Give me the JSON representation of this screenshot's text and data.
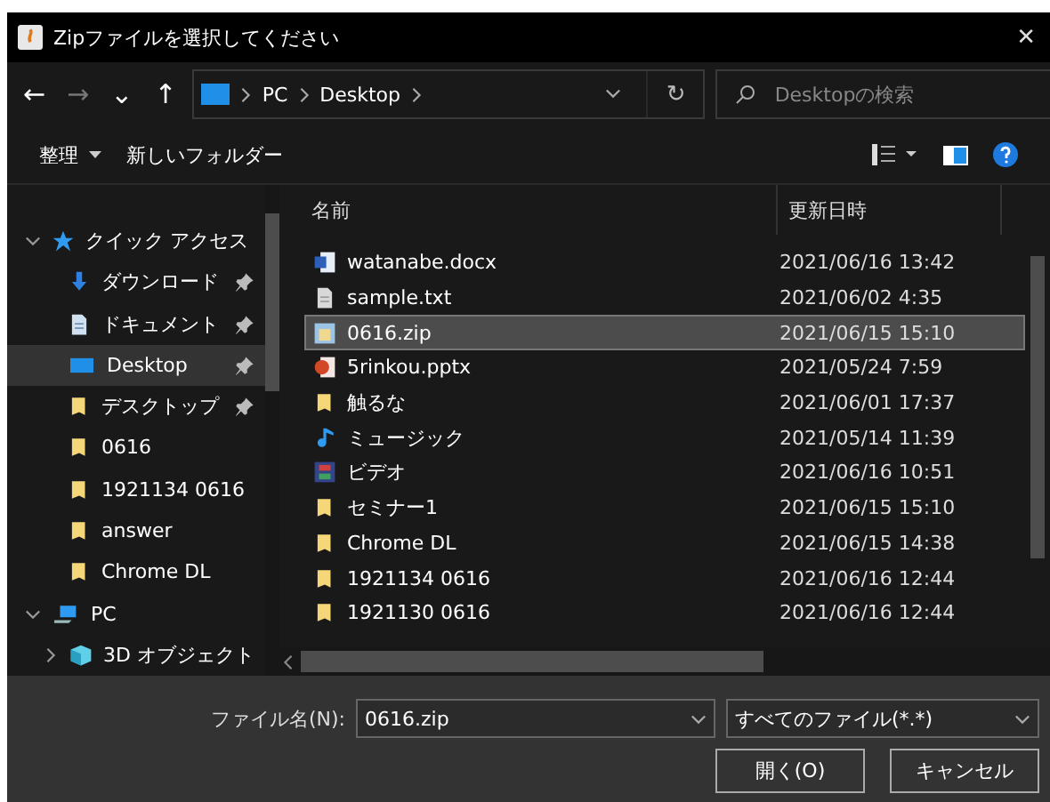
{
  "window": {
    "title": "Zipファイルを選択してください",
    "close": "✕"
  },
  "nav": {
    "back": "←",
    "forward": "→",
    "recent": "⌄",
    "up": "↑",
    "path": [
      {
        "label": "PC"
      },
      {
        "label": "Desktop"
      }
    ],
    "refresh": "↻",
    "search": {
      "placeholder": "Desktopの検索"
    }
  },
  "toolbar": {
    "organize": "整理",
    "new_folder": "新しいフォルダー"
  },
  "sidebar": {
    "items": [
      {
        "label": "クイック アクセス",
        "kind": "star",
        "selected": false,
        "pinned": false,
        "children": [
          {
            "label": "ダウンロード",
            "kind": "download",
            "selected": false,
            "pinned": true
          },
          {
            "label": "ドキュメント",
            "kind": "document",
            "selected": false,
            "pinned": true
          },
          {
            "label": "Desktop",
            "kind": "desktop",
            "selected": true,
            "pinned": true
          },
          {
            "label": "デスクトップ",
            "kind": "folder",
            "selected": false,
            "pinned": true
          },
          {
            "label": "0616",
            "kind": "folder",
            "selected": false,
            "pinned": false
          },
          {
            "label": "1921134 0616",
            "kind": "folder",
            "selected": false,
            "pinned": false
          },
          {
            "label": "answer",
            "kind": "folder",
            "selected": false,
            "pinned": false
          },
          {
            "label": "Chrome DL",
            "kind": "folder",
            "selected": false,
            "pinned": false
          }
        ]
      },
      {
        "label": "PC",
        "kind": "pc",
        "selected": false,
        "pinned": false,
        "children": [
          {
            "label": "3D オブジェクト",
            "kind": "cube",
            "selected": false,
            "pinned": false
          }
        ]
      }
    ]
  },
  "table": {
    "columns": [
      "名前",
      "更新日時"
    ],
    "rows": [
      {
        "name": "watanabe.docx",
        "date": "2021/06/16 13:42",
        "kind": "word",
        "selected": false
      },
      {
        "name": "sample.txt",
        "date": "2021/06/02 4:35",
        "kind": "text",
        "selected": false
      },
      {
        "name": "0616.zip",
        "date": "2021/06/15 15:10",
        "kind": "zip",
        "selected": true
      },
      {
        "name": "5rinkou.pptx",
        "date": "2021/05/24 7:59",
        "kind": "slides",
        "selected": false
      },
      {
        "name": "触るな",
        "date": "2021/06/01 17:37",
        "kind": "folder",
        "selected": false
      },
      {
        "name": "ミュージック",
        "date": "2021/05/14 11:39",
        "kind": "music",
        "selected": false
      },
      {
        "name": "ビデオ",
        "date": "2021/06/16 10:51",
        "kind": "video",
        "selected": false
      },
      {
        "name": "セミナー1",
        "date": "2021/06/15 15:10",
        "kind": "folder",
        "selected": false
      },
      {
        "name": "Chrome DL",
        "date": "2021/06/15 14:38",
        "kind": "folder",
        "selected": false
      },
      {
        "name": "1921134 0616",
        "date": "2021/06/16 12:44",
        "kind": "folder",
        "selected": false
      },
      {
        "name": "1921130 0616",
        "date": "2021/06/16 12:44",
        "kind": "folder",
        "selected": false
      }
    ]
  },
  "footer": {
    "filename_label": "ファイル名(N):",
    "filename": "0616.zip",
    "filter": "すべてのファイル(*.*)",
    "open": "開く(O)",
    "cancel": "キャンセル"
  }
}
